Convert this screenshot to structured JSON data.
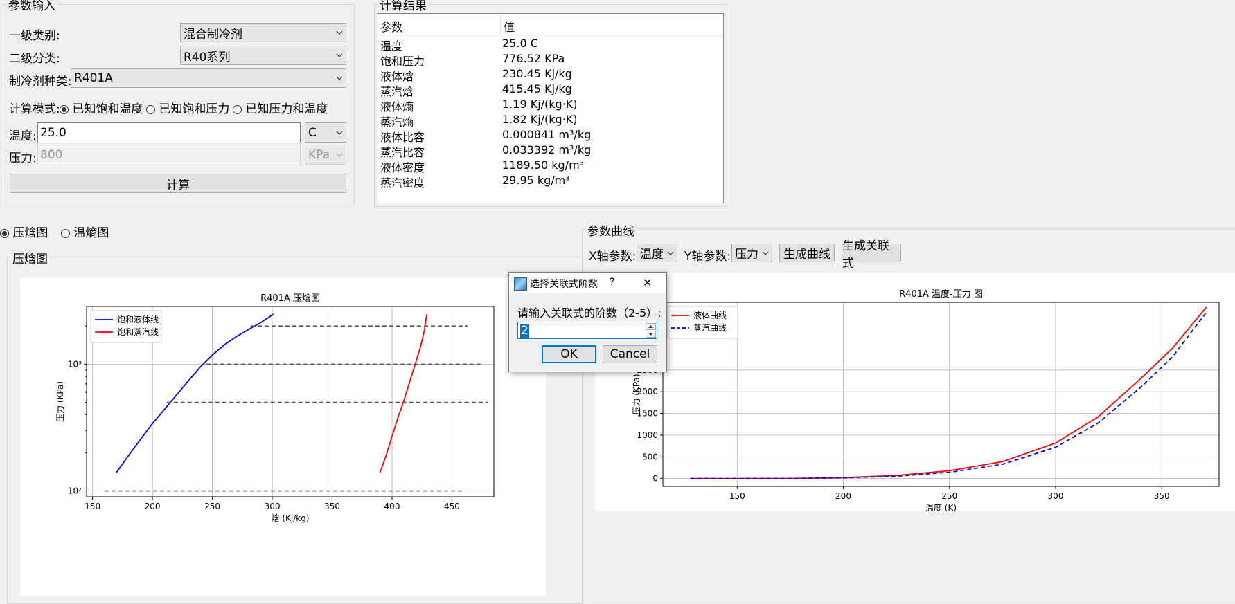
{
  "input_panel": {
    "title": "参数输入",
    "category1_label": "一级类别:",
    "category1_value": "混合制冷剂",
    "category2_label": "二级分类:",
    "category2_value": "R40系列",
    "refrigerant_label": "制冷剂种类:",
    "refrigerant_value": "R401A",
    "mode_label": "计算模式:",
    "modes": [
      "已知饱和温度",
      "已知饱和压力",
      "已知压力和温度"
    ],
    "temp_label": "温度:",
    "temp_value": "25.0",
    "temp_unit": "C",
    "pressure_label": "压力:",
    "pressure_value": "800",
    "pressure_unit": "KPa",
    "calc_button": "计算"
  },
  "result_panel": {
    "title": "计算结果",
    "header_param": "参数",
    "header_value": "值",
    "rows": [
      {
        "param": "温度",
        "value": "25.0 C"
      },
      {
        "param": "饱和压力",
        "value": "776.52 KPa"
      },
      {
        "param": "液体焓",
        "value": "230.45 Kj/kg"
      },
      {
        "param": "蒸汽焓",
        "value": "415.45 Kj/kg"
      },
      {
        "param": "液体熵",
        "value": "1.19 Kj/(kg·K)"
      },
      {
        "param": "蒸汽熵",
        "value": "1.82 Kj/(kg·K)"
      },
      {
        "param": "液体比容",
        "value": "0.000841 m³/kg"
      },
      {
        "param": "蒸汽比容",
        "value": "0.033392 m³/kg"
      },
      {
        "param": "液体密度",
        "value": "1189.50 kg/m³"
      },
      {
        "param": "蒸汽密度",
        "value": "29.95 kg/m³"
      }
    ]
  },
  "diagram_type": {
    "options": [
      "压焓图",
      "温熵图"
    ],
    "selected": "压焓图"
  },
  "ph_panel": {
    "title": "压焓图"
  },
  "curve_panel": {
    "title": "参数曲线",
    "x_label": "X轴参数:",
    "x_value": "温度",
    "y_label": "Y轴参数:",
    "y_value": "压力",
    "gen_curve": "生成曲线",
    "gen_corr": "生成关联式"
  },
  "dialog": {
    "title": "选择关联式阶数",
    "help": "?",
    "close": "✕",
    "prompt": "请输入关联式的阶数（2-5）:",
    "value": "2",
    "ok": "OK",
    "cancel": "Cancel"
  },
  "chart_data": [
    {
      "type": "line",
      "title": "R401A 压焓图",
      "xlabel": "焓 (Kj/kg)",
      "ylabel": "压力 (KPa)",
      "xlim": [
        145,
        485
      ],
      "ylim": [
        90,
        2850
      ],
      "yscale": "log",
      "xticks": [
        150,
        200,
        250,
        300,
        350,
        400,
        450
      ],
      "yticks": [
        {
          "value": 100,
          "label": "10²"
        },
        {
          "value": 1000,
          "label": "10³"
        }
      ],
      "grid": true,
      "legend": "top-left",
      "series": [
        {
          "name": "饱和液体线",
          "color": "#0000ff",
          "points": [
            [
              170,
              140
            ],
            [
              180,
              190
            ],
            [
              190,
              255
            ],
            [
              200,
              340
            ],
            [
              210,
              440
            ],
            [
              220,
              570
            ],
            [
              230,
              740
            ],
            [
              240,
              950
            ],
            [
              250,
              1180
            ],
            [
              260,
              1420
            ],
            [
              270,
              1650
            ],
            [
              280,
              1870
            ],
            [
              290,
              2120
            ],
            [
              301,
              2480
            ]
          ]
        },
        {
          "name": "饱和蒸汽线",
          "color": "#ff0000",
          "points": [
            [
              390,
              140
            ],
            [
              395,
              190
            ],
            [
              400,
              270
            ],
            [
              405,
              380
            ],
            [
              410,
              520
            ],
            [
              415,
              740
            ],
            [
              420,
              1050
            ],
            [
              424,
              1400
            ],
            [
              427,
              1850
            ],
            [
              428,
              2150
            ],
            [
              429,
              2480
            ]
          ]
        },
        {
          "color": "#555555",
          "dashed": true,
          "points": [
            [
              160,
              100
            ],
            [
              460,
              100
            ]
          ]
        },
        {
          "color": "#555555",
          "dashed": true,
          "points": [
            [
              212,
              500
            ],
            [
              480,
              500
            ]
          ]
        },
        {
          "color": "#555555",
          "dashed": true,
          "points": [
            [
              245,
              1000
            ],
            [
              475,
              1000
            ]
          ]
        },
        {
          "color": "#555555",
          "dashed": true,
          "points": [
            [
              282,
              2000
            ],
            [
              463,
              2000
            ]
          ]
        }
      ]
    },
    {
      "type": "line",
      "title": "R401A 温度-压力 图",
      "xlabel": "温度 (K)",
      "ylabel": "压力 (KPa)",
      "xlim": [
        115,
        377
      ],
      "ylim": [
        -180,
        4060
      ],
      "xticks": [
        150,
        200,
        250,
        300,
        350
      ],
      "yticks": [
        0,
        500,
        1000,
        1500,
        2000,
        2500
      ],
      "grid": true,
      "legend": "top-left",
      "series": [
        {
          "name": "液体曲线",
          "color": "#ff0000",
          "dashed": false,
          "points": [
            [
              128,
              0
            ],
            [
              150,
              1
            ],
            [
              175,
              4
            ],
            [
              200,
              22
            ],
            [
              225,
              70
            ],
            [
              250,
              180
            ],
            [
              275,
              390
            ],
            [
              300,
              820
            ],
            [
              320,
              1420
            ],
            [
              340,
              2300
            ],
            [
              355,
              3000
            ],
            [
              371,
              3950
            ]
          ]
        },
        {
          "name": "蒸汽曲线",
          "color": "#0000ff",
          "dashed": true,
          "points": [
            [
              128,
              0
            ],
            [
              150,
              1
            ],
            [
              175,
              3
            ],
            [
              200,
              17
            ],
            [
              225,
              55
            ],
            [
              250,
              145
            ],
            [
              275,
              330
            ],
            [
              300,
              720
            ],
            [
              320,
              1280
            ],
            [
              340,
              2100
            ],
            [
              355,
              2800
            ],
            [
              371,
              3830
            ]
          ]
        }
      ]
    }
  ]
}
